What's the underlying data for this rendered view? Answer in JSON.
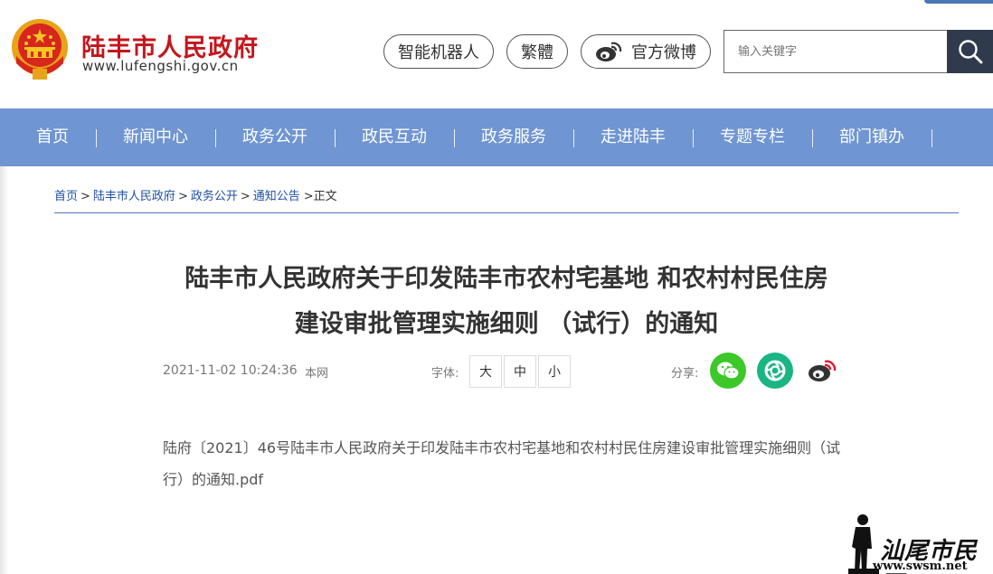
{
  "header": {
    "site_name": "陆丰市人民政府",
    "site_url": "www.lufengshi.gov.cn",
    "robot_label": "智能机器人",
    "traditional_label": "繁體",
    "weibo_label": "官方微博",
    "search_placeholder": "输入关键字",
    "emblem_icon": "national-emblem-icon",
    "search_icon": "search-icon"
  },
  "nav": {
    "items": [
      "首页",
      "新闻中心",
      "政务公开",
      "政民互动",
      "政务服务",
      "走进陆丰",
      "专题专栏",
      "部门镇办"
    ]
  },
  "breadcrumb": {
    "items": [
      "首页",
      "陆丰市人民政府",
      "政务公开",
      "通知公告"
    ],
    "current": ">正文"
  },
  "article": {
    "title_line1": "陆丰市人民政府关于印发陆丰市农村宅基地 和农村村民住房",
    "title_line2": "建设审批管理实施细则 （试行）的通知",
    "date": "2021-11-02 10:24:36",
    "source": "本网",
    "font_label": "字体:",
    "font_sizes": [
      "大",
      "中",
      "小"
    ],
    "share_label": "分享:",
    "share_icons": [
      "wechat-icon",
      "moments-icon",
      "weibo-icon"
    ],
    "attachment": "陆府〔2021〕46号陆丰市人民政府关于印发陆丰市农村宅基地和农村村民住房建设审批管理实施细则（试行）的通知.pdf"
  },
  "watermark": {
    "text": "汕尾市民网",
    "url": "www.swsm.net"
  },
  "colors": {
    "nav_bg": "#6f95d2",
    "brand_red": "#c4161c",
    "search_btn": "#2f3b4d",
    "wechat_green": "#3dc829",
    "moments_green": "#19b583"
  }
}
